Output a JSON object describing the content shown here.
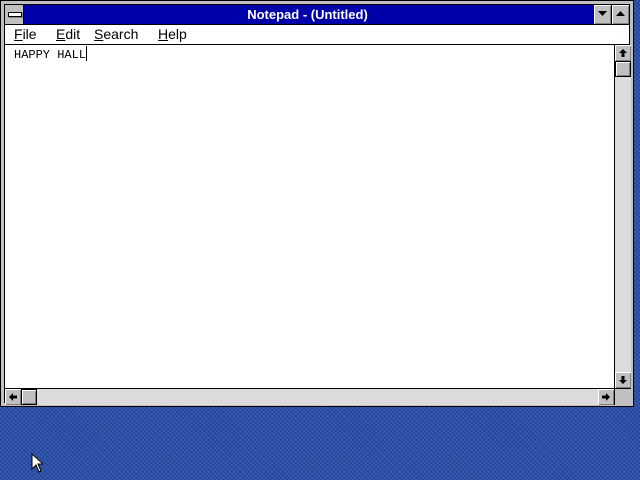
{
  "window": {
    "title": "Notepad - (Untitled)"
  },
  "title_buttons": {
    "system_menu_icon": "system-menu-bar-icon",
    "minimize_icon": "down-triangle-icon",
    "maximize_icon": "up-triangle-icon"
  },
  "menu": {
    "items": [
      {
        "accel": "F",
        "rest": "ile"
      },
      {
        "accel": "E",
        "rest": "dit"
      },
      {
        "accel": "S",
        "rest": "earch"
      },
      {
        "accel": "H",
        "rest": "elp"
      }
    ]
  },
  "editor": {
    "text": "HAPPY HALL"
  },
  "scrollbars": {
    "vertical": {
      "up_icon": "up-arrow-icon",
      "down_icon": "down-arrow-icon",
      "position": 0
    },
    "horizontal": {
      "left_icon": "left-arrow-icon",
      "right_icon": "right-arrow-icon",
      "position": 0
    }
  },
  "desktop": {
    "pointer_icon": "arrow-cursor-icon"
  },
  "colors": {
    "title_bar": "#0000a8",
    "window_frame": "#c0c0c0",
    "desktop": "#2a4fa8"
  }
}
